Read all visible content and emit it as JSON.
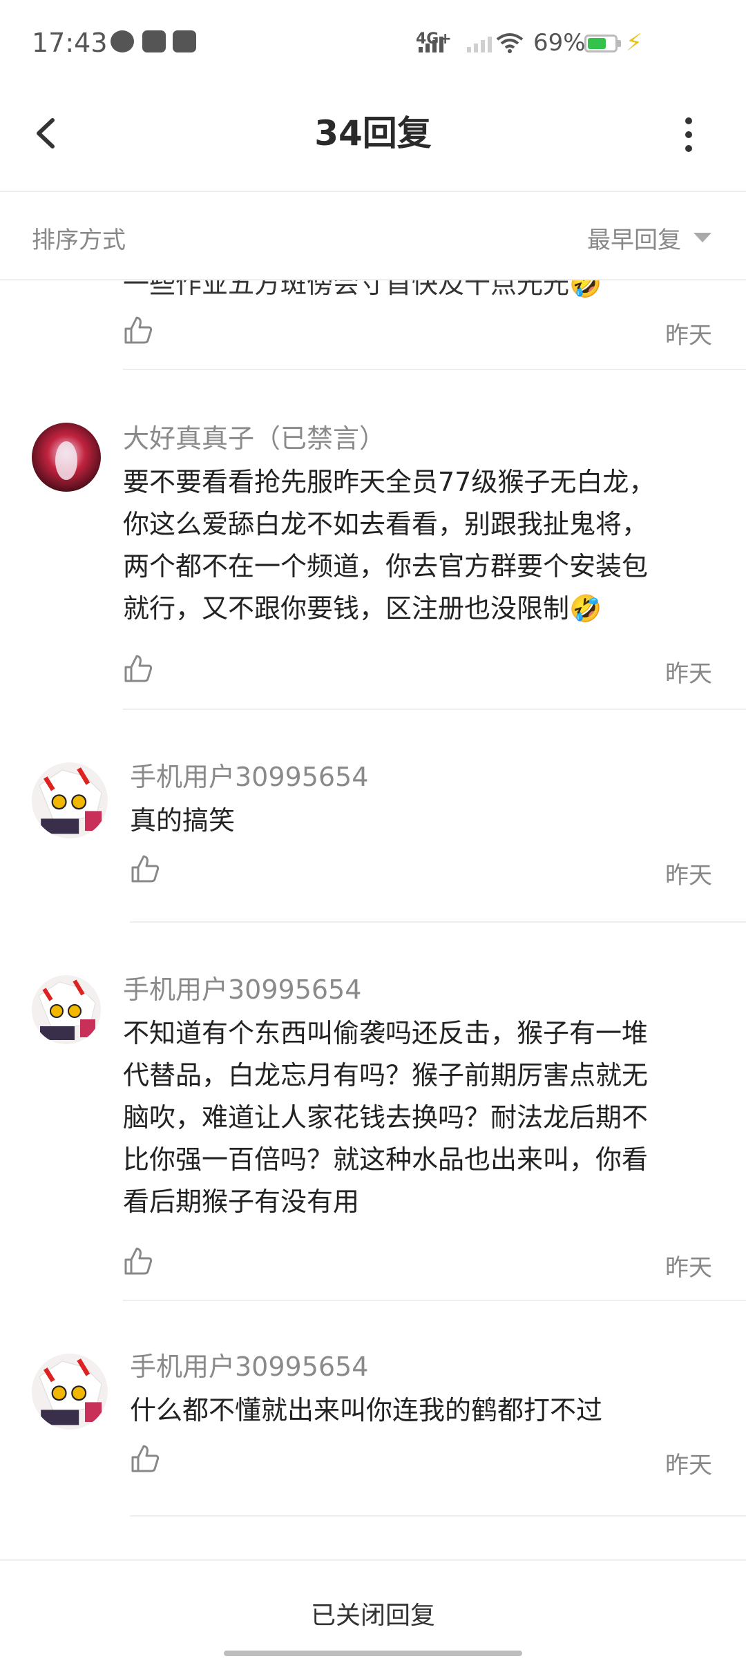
{
  "status_bar": {
    "time": "17:43",
    "network": "4G+",
    "battery_pct": "69%",
    "battery_level": 0.69,
    "icons": [
      "message-icon",
      "taobao-icon",
      "baidu-icon"
    ]
  },
  "header": {
    "title": "34回复"
  },
  "sort": {
    "label": "排序方式",
    "value": "最早回复"
  },
  "list": {
    "partial_text": "一些作业五方斑傍会寸首快及十点光光🤣",
    "partial_date": "昨天",
    "comments": [
      {
        "name": "大好真真子（已禁言）",
        "text": "要不要看看抢先服昨天全员77级猴子无白龙，\n你这么爱舔白龙不如去看看，别跟我扯鬼将，\n两个都不在一个频道，你去官方群要个安装包\n就行，又不跟你要钱，区注册也没限制🤣",
        "date": "昨天"
      },
      {
        "name": "手机用户30995654",
        "text": "真的搞笑",
        "date": "昨天"
      },
      {
        "name": "手机用户30995654",
        "text": "不知道有个东西叫偷袭吗还反击，猴子有一堆\n代替品，白龙忘月有吗？猴子前期厉害点就无\n脑吹，难道让人家花钱去换吗？耐法龙后期不\n比你强一百倍吗？就这种水品也出来叫，你看\n看后期猴子有没有用",
        "date": "昨天"
      },
      {
        "name": "手机用户30995654",
        "text": "什么都不懂就出来叫你连我的鹤都打不过",
        "date": "昨天"
      }
    ]
  },
  "footer": {
    "closed_label": "已关闭回复"
  },
  "colors": {
    "battery": "#35c24a",
    "bolt": "#e8c21a",
    "divider": "#eeeeee",
    "secondary_text": "#888888"
  }
}
